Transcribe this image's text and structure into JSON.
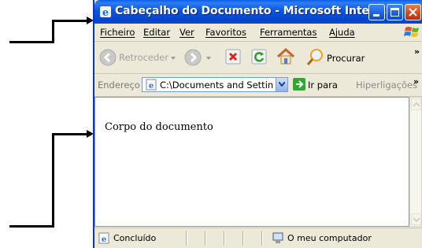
{
  "window": {
    "title": "Cabeçalho do Documento - Microsoft Intern...",
    "controls": {
      "minimize": "minimize",
      "maximize": "maximize",
      "close": "close"
    }
  },
  "menubar": {
    "items": [
      "Ficheiro",
      "Editar",
      "Ver",
      "Favoritos",
      "Ferramentas",
      "Ajuda"
    ]
  },
  "toolbar": {
    "back_label": "Retroceder",
    "search_label": "Procurar",
    "more": "»"
  },
  "addressbar": {
    "label": "Endereço",
    "value": "C:\\Documents and Settin",
    "go_label": "Ir para",
    "links_label": "Hiperligações",
    "more": "»"
  },
  "document": {
    "body_text": "Corpo do documento"
  },
  "statusbar": {
    "status": "Concluído",
    "zone": "O meu computador"
  },
  "colors": {
    "titlebar": "#0a56dd",
    "close_button": "#d3461f",
    "chrome": "#ece9d8"
  }
}
